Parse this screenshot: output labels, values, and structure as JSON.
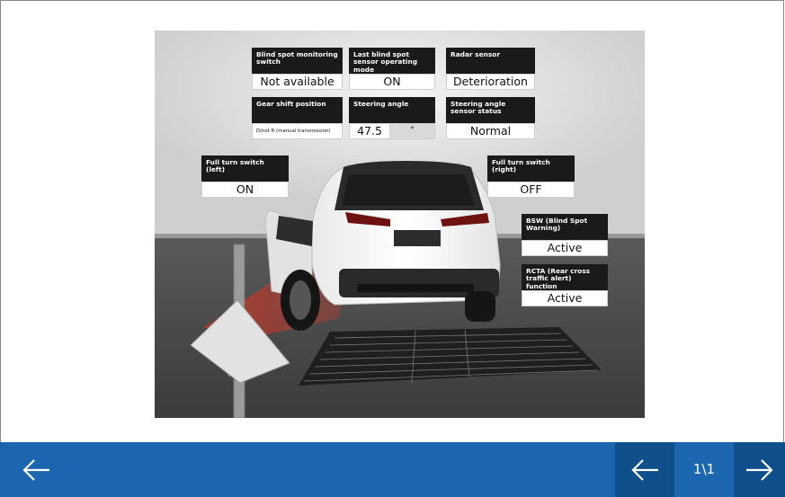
{
  "panels": {
    "bsm_switch": {
      "label": "Blind spot monitoring switch",
      "value": "Not available"
    },
    "last_mode": {
      "label": "Last blind spot sensor operating  mode",
      "value": "ON"
    },
    "radar": {
      "label": "Radar sensor",
      "value": "Deterioration"
    },
    "gear": {
      "label": "Gear shift position",
      "value": "D/not R (manual transmission)"
    },
    "steering_angle": {
      "label": "Steering angle",
      "value": "47.5",
      "unit": "°"
    },
    "steering_sensor": {
      "label": "Steering angle sensor status",
      "value": "Normal"
    },
    "turn_left": {
      "label": "Full turn switch (left)",
      "value": "ON"
    },
    "turn_right": {
      "label": "Full turn switch (right)",
      "value": "OFF"
    },
    "bsw": {
      "label": "BSW (Blind Spot Warning)",
      "value": "Active"
    },
    "rcta": {
      "label": "RCTA (Rear cross traffic  alert) function",
      "value": "Active"
    }
  },
  "nav": {
    "page_indicator": "1\\1",
    "back_icon": "arrow-left-icon",
    "prev_icon": "arrow-left-icon",
    "next_icon": "arrow-right-icon"
  },
  "colors": {
    "bar": "#1b66ae",
    "bar_dark": "#0e4f8c",
    "panel_header": "#1a1a1a"
  }
}
